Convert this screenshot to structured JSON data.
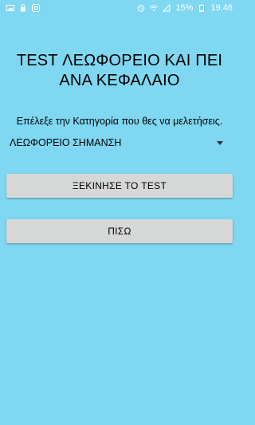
{
  "status_bar": {
    "battery_percent": "15%",
    "time": "19:46",
    "color": "#ffffff",
    "icons_left": [
      "image-icon",
      "lock-icon",
      "camera-icon"
    ],
    "icons_right": [
      "alarm-icon",
      "wifi-icon",
      "signal-icon",
      "battery-icon"
    ]
  },
  "screen": {
    "background_color": "#7fd7f1",
    "title": "TEST ΛΕΩΦΟΡΕΙΟ ΚΑΙ ΠΕΙ ΑΝΑ ΚΕΦΑΛΑΙΟ",
    "prompt": "Επέλεξε την Κατηγορία που θες να μελετήσεις.",
    "category_select": {
      "selected": "ΛΕΩΦΟΡΕΙΟ ΣΗΜΑΝΣΗ"
    },
    "start_button_label": "ΞΕΚΙΝΗΣΕ ΤΟ TEST",
    "back_button_label": "ΠΙΣΩ",
    "button_color": "#d6d7d7"
  }
}
